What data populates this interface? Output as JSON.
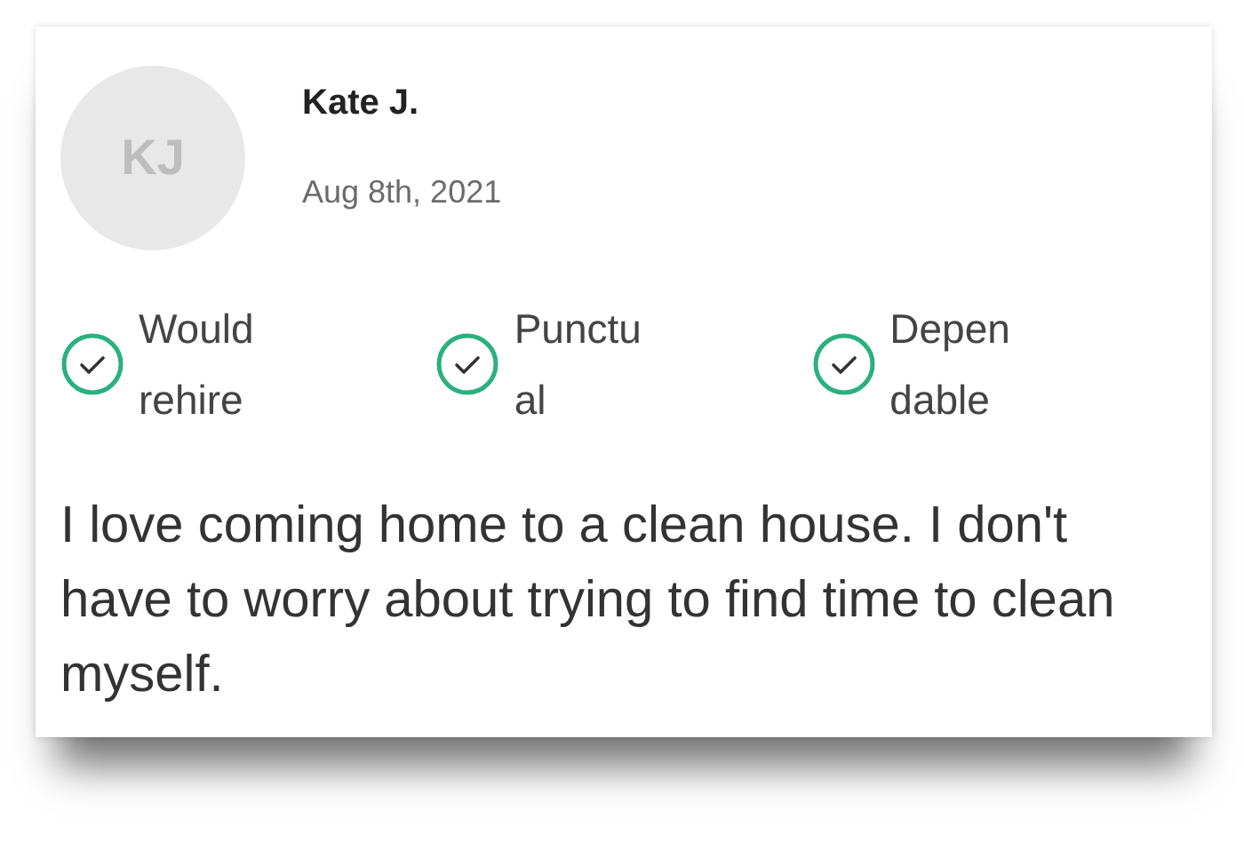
{
  "review": {
    "avatar_initials": "KJ",
    "name": "Kate J.",
    "date": "Aug 8th, 2021",
    "tags": [
      {
        "label": "Would rehire",
        "checked": true
      },
      {
        "label": "Punctual",
        "checked": true
      },
      {
        "label": "Dependable",
        "checked": true
      }
    ],
    "text": "I love coming home to a clean house. I don't have to worry about trying to find time to clean myself."
  }
}
